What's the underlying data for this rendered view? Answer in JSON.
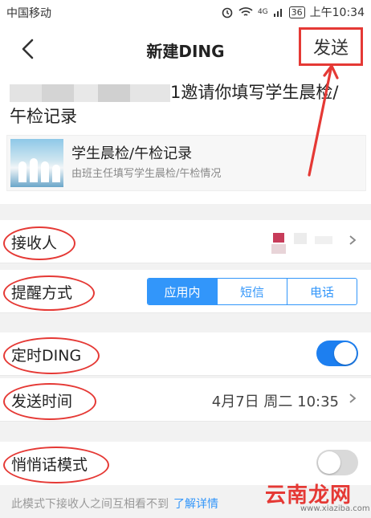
{
  "status_bar": {
    "carrier": "中国移动",
    "battery": "36",
    "network": "4G",
    "time": "上午10:34"
  },
  "nav": {
    "title": "新建DING",
    "send_label": "发送"
  },
  "message": {
    "invite_text": "1邀请你填写学生晨检/午检记录",
    "card_title": "学生晨检/午检记录",
    "card_subtitle": "由班主任填写学生晨检/午检情况"
  },
  "recipient": {
    "label": "接收人"
  },
  "reminder": {
    "label": "提醒方式",
    "options": [
      "应用内",
      "短信",
      "电话"
    ],
    "selected": "应用内"
  },
  "scheduled": {
    "label": "定时DING",
    "enabled": true
  },
  "send_time": {
    "label": "发送时间",
    "value": "4月7日 周二 10:35"
  },
  "whisper": {
    "label": "悄悄话模式",
    "enabled": false
  },
  "footer": {
    "note": "此模式下接收人之间互相看不到",
    "link": "了解详情"
  },
  "watermark": {
    "text": "云南龙网",
    "url": "www.xiaziba.com"
  },
  "colors": {
    "accent": "#3296fa",
    "annotation": "#e53935",
    "toggle_on": "#1d7ff0"
  }
}
